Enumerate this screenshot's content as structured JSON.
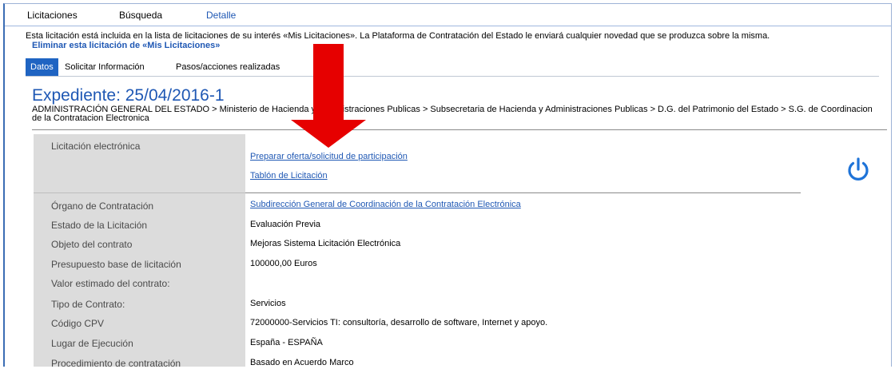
{
  "topnav": {
    "tabs": [
      "Licitaciones",
      "Búsqueda",
      "Detalle"
    ]
  },
  "notice": {
    "text": "Esta licitación está incluida en la lista de licitaciones de su interés «Mis Licitaciones». La Plataforma de Contratación del Estado le enviará cualquier novedad que se produzca sobre la misma.",
    "link": "Eliminar esta licitación de «Mis Licitaciones»"
  },
  "subtabs": [
    "Datos",
    "Solicitar Información",
    "Pasos/acciones realizadas"
  ],
  "expediente": {
    "title": "Expediente:  25/04/2016-1",
    "breadcrumb": "ADMINISTRACIÓN GENERAL DEL ESTADO > Ministerio de Hacienda y Administraciones Publicas > Subsecretaria de Hacienda y Administraciones Publicas > D.G. del Patrimonio del Estado > S.G. de Coordinacion de la Contratacion Electronica"
  },
  "electronic": {
    "label": "Licitación electrónica",
    "links": [
      "Preparar oferta/solicitud de participación",
      "Tablón de Licitación"
    ]
  },
  "details": [
    {
      "label": "Órgano de Contratación",
      "value": "Subdirección General de Coordinación de la Contratación Electrónica",
      "link": true
    },
    {
      "label": "Estado de la Licitación",
      "value": "Evaluación Previa"
    },
    {
      "label": "Objeto del contrato",
      "value": "Mejoras Sistema Licitación Electrónica"
    },
    {
      "label": "Presupuesto base de licitación",
      "value": "100000,00   Euros"
    },
    {
      "label": "Valor estimado del contrato:",
      "value": ""
    },
    {
      "label": "Tipo de Contrato:",
      "value": "Servicios"
    },
    {
      "label": "Código CPV",
      "value": "72000000-Servicios TI: consultoría, desarrollo de software, Internet y apoyo."
    },
    {
      "label": "Lugar de Ejecución",
      "value": "España - ESPAÑA"
    },
    {
      "label": "Procedimiento de contratación",
      "value": "Basado en Acuerdo Marco"
    }
  ],
  "colors": {
    "accent": "#1f58b4",
    "tab_active": "#1f64c2",
    "arrow": "#e60000",
    "label_bg": "#dcdcdc"
  },
  "icons": {
    "power": "power-icon",
    "arrow": "down-arrow-icon"
  }
}
